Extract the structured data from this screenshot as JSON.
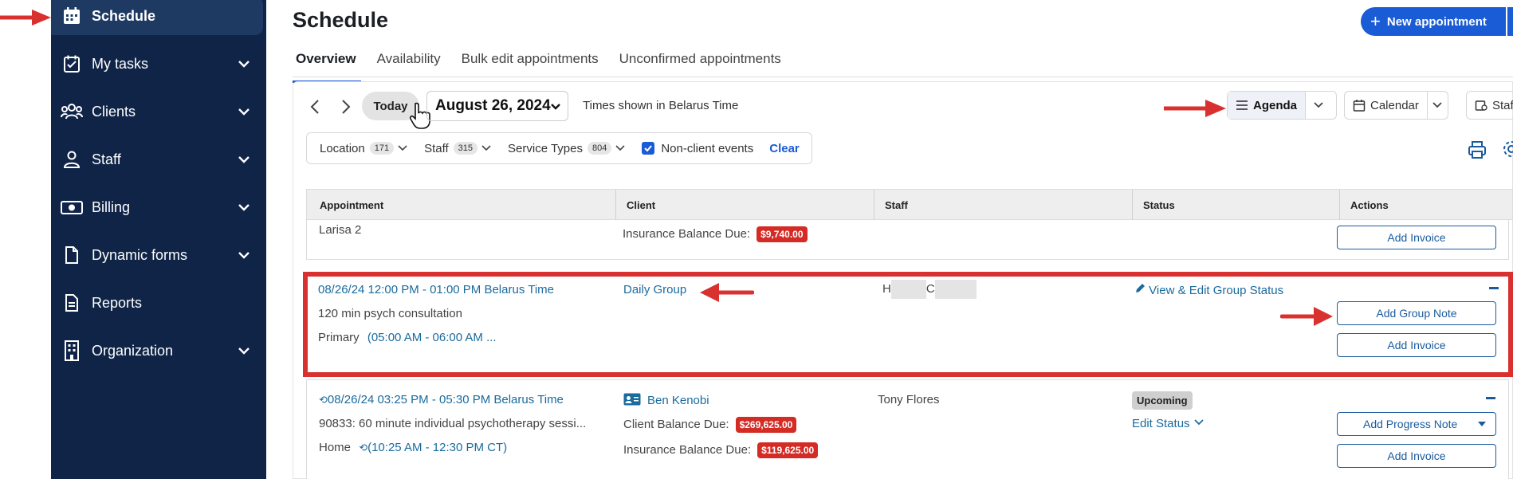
{
  "sidebar": {
    "items": [
      {
        "label": "Schedule",
        "icon": "calendar-icon"
      },
      {
        "label": "My tasks",
        "icon": "task-icon"
      },
      {
        "label": "Clients",
        "icon": "clients-icon"
      },
      {
        "label": "Staff",
        "icon": "staff-icon"
      },
      {
        "label": "Billing",
        "icon": "billing-icon"
      },
      {
        "label": "Dynamic forms",
        "icon": "document-icon"
      },
      {
        "label": "Reports",
        "icon": "reports-icon"
      },
      {
        "label": "Organization",
        "icon": "building-icon"
      }
    ]
  },
  "header": {
    "title": "Schedule",
    "new_appointment": "New appointment"
  },
  "tabs": [
    {
      "label": "Overview"
    },
    {
      "label": "Availability"
    },
    {
      "label": "Bulk edit appointments"
    },
    {
      "label": "Unconfirmed appointments"
    }
  ],
  "toolbar": {
    "today": "Today",
    "date": "August 26, 2024",
    "timezone_note": "Times shown in Belarus Time",
    "views": {
      "agenda": "Agenda",
      "calendar": "Calendar",
      "staff": "Staff"
    }
  },
  "filters": {
    "location": {
      "label": "Location",
      "count": "171"
    },
    "staff": {
      "label": "Staff",
      "count": "315"
    },
    "service_types": {
      "label": "Service Types",
      "count": "804"
    },
    "non_client": "Non-client events",
    "clear": "Clear"
  },
  "table": {
    "headers": {
      "appointment": "Appointment",
      "client": "Client",
      "staff": "Staff",
      "status": "Status",
      "actions": "Actions"
    },
    "rows": [
      {
        "appointment": "Larisa 2",
        "balance_label": "Insurance Balance Due:",
        "balance": "$9,740.00",
        "action": "Add Invoice"
      },
      {
        "time": "08/26/24 12:00 PM - 01:00 PM Belarus Time",
        "service": "120 min psych consultation",
        "location": "Primary",
        "local_time": "(05:00 AM - 06:00 AM ...",
        "client": "Daily Group",
        "staff_initial_1": "H",
        "staff_initial_2": "C",
        "status_link": "View & Edit Group Status",
        "action_1": "Add Group Note",
        "action_2": "Add Invoice"
      },
      {
        "time": "08/26/24 03:25 PM - 05:30 PM Belarus Time",
        "service": "90833: 60 minute individual psychotherapy sessi...",
        "location": "Home",
        "local_time": "(10:25 AM - 12:30 PM CT)",
        "client": "Ben Kenobi",
        "client_balance_label": "Client Balance Due:",
        "client_balance": "$269,625.00",
        "insurance_balance_label": "Insurance Balance Due:",
        "insurance_balance": "$119,625.00",
        "staff": "Tony Flores",
        "status": "Upcoming",
        "edit_status": "Edit Status",
        "action_1": "Add Progress Note",
        "action_2": "Add Invoice"
      }
    ]
  },
  "colors": {
    "sidebar": "#0f2447",
    "primary": "#1a5bd6",
    "annotation": "#d93030",
    "balance": "#d42b25"
  }
}
